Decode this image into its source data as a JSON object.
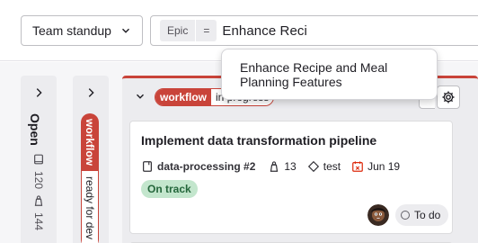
{
  "filter_bar": {
    "board_select": {
      "value": "Team standup",
      "icon": "chevron-down-icon"
    },
    "search": {
      "token_name": "Epic",
      "token_operator": "=",
      "query": "Enhance Reci"
    }
  },
  "suggestions": [
    {
      "label": "Enhance Recipe and Meal Planning Features"
    }
  ],
  "columns": {
    "open": {
      "title": "Open",
      "issue_count": "120",
      "weight_count": "144"
    },
    "ready": {
      "label_key": "workflow",
      "label_value": "ready for dev"
    },
    "in_progress": {
      "label_key": "workflow",
      "label_value": "in progress"
    }
  },
  "card": {
    "title": "Implement data transformation pipeline",
    "reference": "data-processing #2",
    "weight": "13",
    "milestone": "test",
    "due_date": "Jun 19",
    "health": "On track",
    "status": "To do"
  },
  "colors": {
    "workflow_label": "#c9443a",
    "on_track_bg": "#c3e6cd",
    "on_track_text": "#24663b",
    "overdue_icon": "#dd2b0e"
  }
}
